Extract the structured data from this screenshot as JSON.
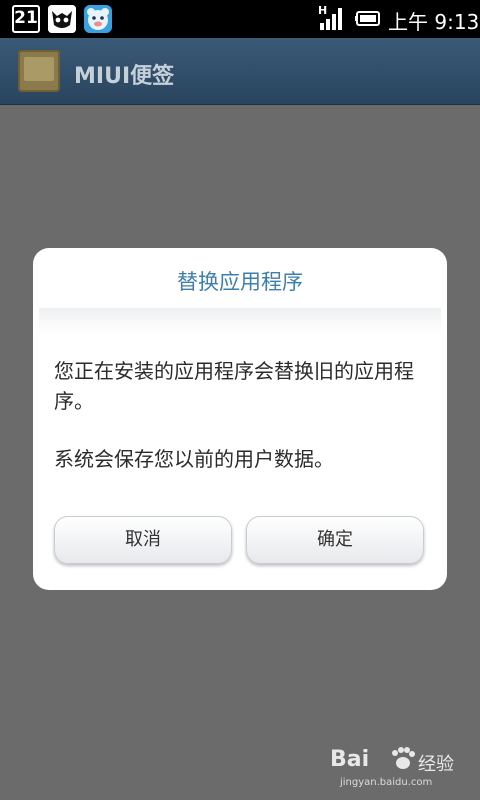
{
  "status_bar": {
    "calendar_day": "21",
    "network": "H",
    "time": "上午 9:13",
    "icons": [
      "calendar-icon",
      "cat-app-icon",
      "bear-app-icon",
      "signal-icon",
      "battery-icon"
    ]
  },
  "app": {
    "title": "MIUI便签"
  },
  "dialog": {
    "title": "替换应用程序",
    "message": "您正在安装的应用程序会替换旧的应用程序。",
    "note": "系统会保存您以前的用户数据。",
    "cancel_label": "取消",
    "ok_label": "确定"
  },
  "watermark": {
    "brand": "Bai",
    "cn": "经验",
    "url": "jingyan.baidu.com"
  },
  "colors": {
    "accent": "#3f7fae",
    "overlay": "#6b6b6b",
    "title_bar": "#29445e"
  }
}
